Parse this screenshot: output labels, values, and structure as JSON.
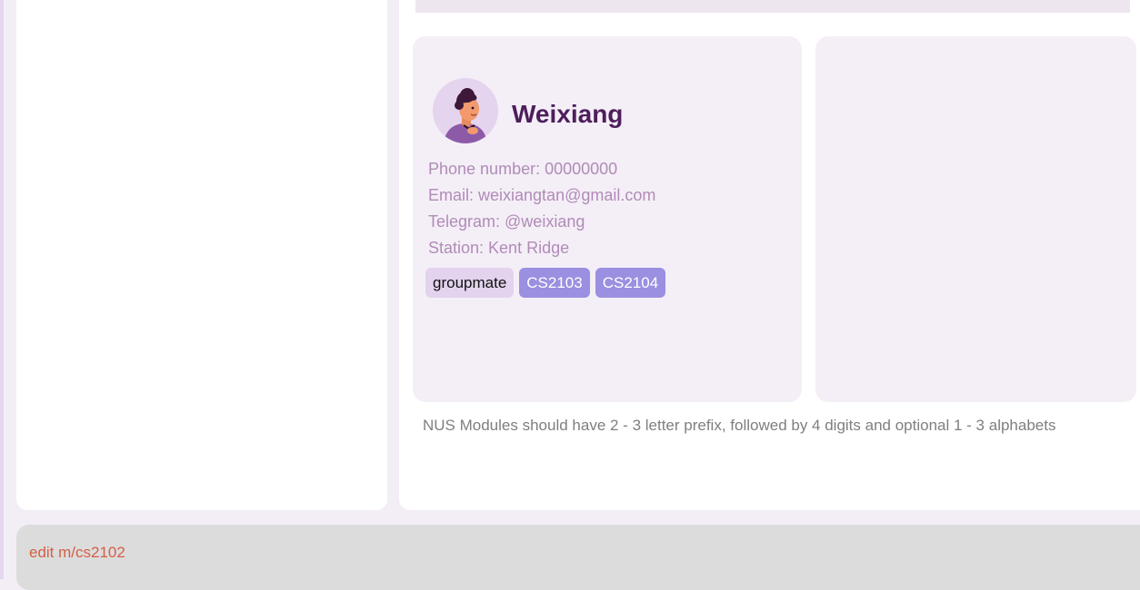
{
  "person_card": {
    "name": "Weixiang",
    "phone": "Phone number: 00000000",
    "email": "Email: weixiangtan@gmail.com",
    "telegram": "Telegram: @weixiang",
    "station": "Station: Kent Ridge",
    "tags": [
      {
        "label": "groupmate",
        "kind": "group"
      },
      {
        "label": "CS2103",
        "kind": "module"
      },
      {
        "label": "CS2104",
        "kind": "module"
      }
    ],
    "avatar_icon": "person-avatar-icon"
  },
  "result_display": {
    "message": "NUS Modules should have 2 - 3 letter prefix, followed by 4 digits and optional 1 - 3 alphabets"
  },
  "command_box": {
    "value": "edit m/cs2102"
  },
  "colors": {
    "name": "#4e1e5c",
    "info_text": "#b18bb7",
    "group_tag": "#e3d3ee",
    "module_tag": "#9a8fe0",
    "command_error_text": "#d35f46",
    "card_bg": "#f4eff7"
  }
}
